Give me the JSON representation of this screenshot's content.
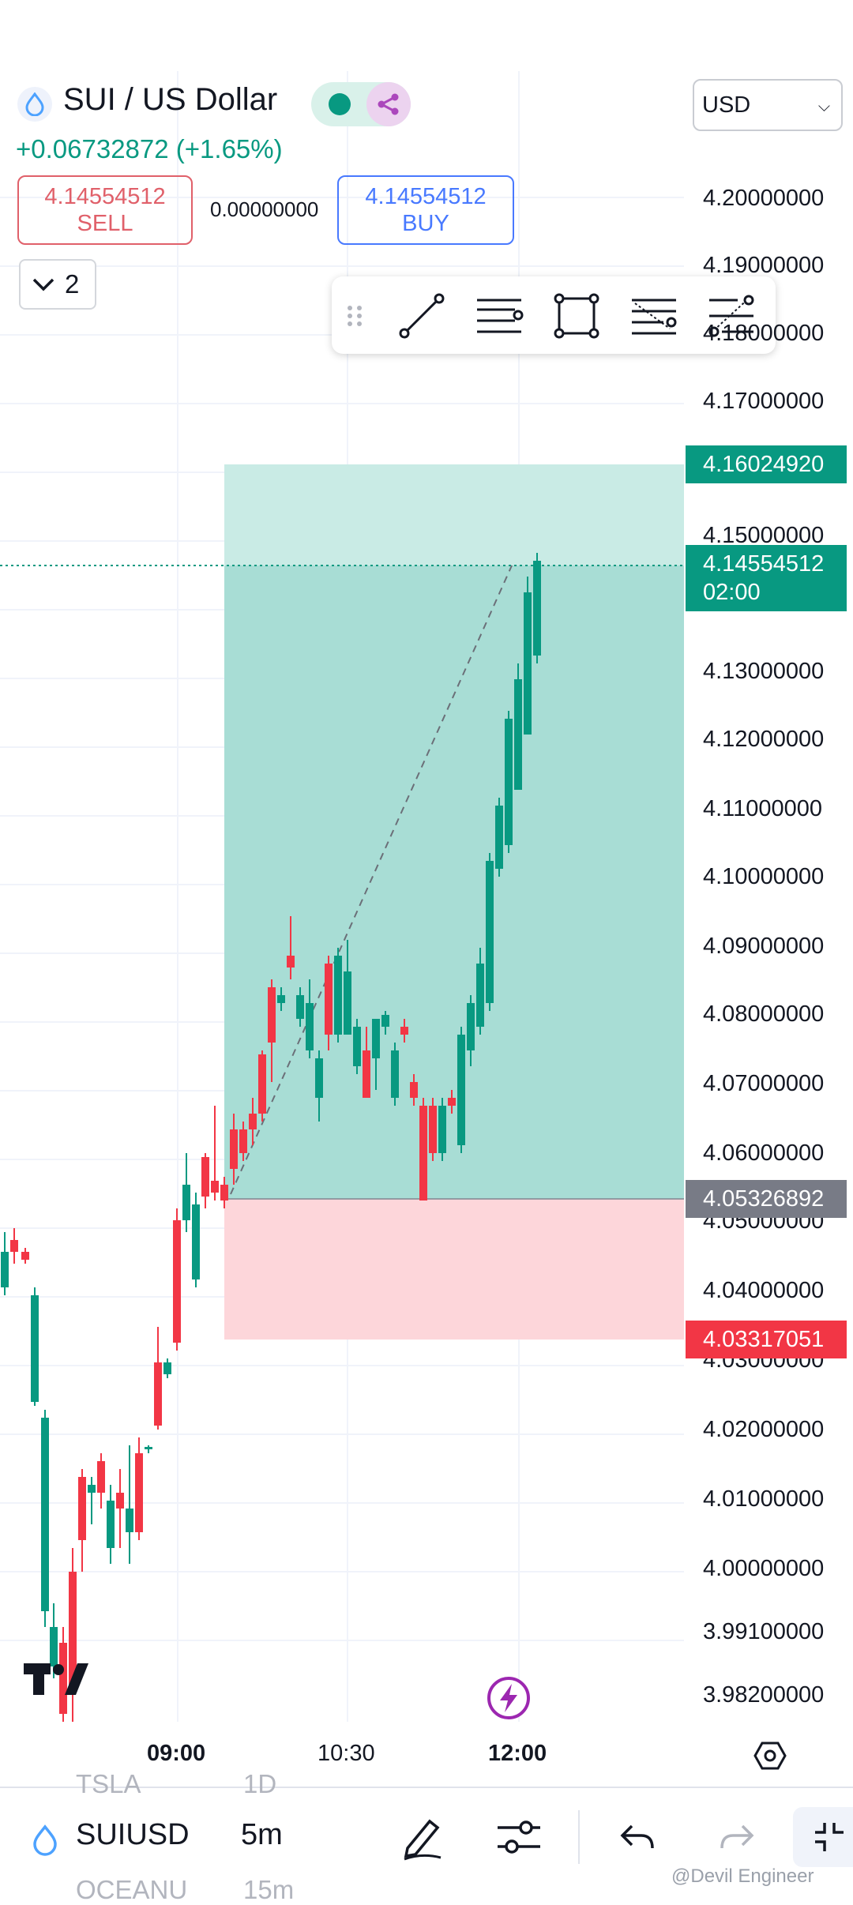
{
  "header": {
    "title": "SUI / US Dollar",
    "change": "+0.06732872 (+1.65%)",
    "currency": "USD"
  },
  "trade": {
    "sell_price": "4.14554512",
    "sell_label": "SELL",
    "spread": "0.00000000",
    "buy_price": "4.14554512",
    "buy_label": "BUY"
  },
  "layers_count": "2",
  "price_axis": [
    "4.20000000",
    "4.19000000",
    "4.18000000",
    "4.17000000",
    "4.15000000",
    "4.13000000",
    "4.12000000",
    "4.11000000",
    "4.10000000",
    "4.09000000",
    "4.08000000",
    "4.07000000",
    "4.06000000",
    "4.05000000",
    "4.04000000",
    "4.03000000",
    "4.02000000",
    "4.01000000",
    "4.00000000",
    "3.99100000",
    "3.98200000"
  ],
  "price_tags": {
    "target": "4.16024920",
    "current": "4.14554512",
    "countdown": "02:00",
    "entry": "4.05326892",
    "stop": "4.03317051"
  },
  "time_axis": [
    "09:00",
    "10:30",
    "12:00"
  ],
  "bottom_bar": {
    "symbol": "SUIUSD",
    "interval": "5m",
    "ghost_prev_symbol": "TSLA",
    "ghost_prev_interval": "1D",
    "ghost_next_symbol": "OCEANU",
    "ghost_next_interval": "15m"
  },
  "watermark": "@Devil Engineer",
  "colors": {
    "up": "#089981",
    "down": "#f23645",
    "target_zone": "#b2dfd8",
    "stop_zone": "#fcd4d8",
    "accent": "#2962ff"
  },
  "icons": [
    "sui-logo-icon",
    "share-icon",
    "chevron-down-icon",
    "drag-handle-icon",
    "trend-line-icon",
    "parallel-lines-icon",
    "rectangle-icon",
    "fib-retracement-icon",
    "fib-extension-icon",
    "tradingview-logo-icon",
    "lightning-icon",
    "settings-gear-icon",
    "pencil-icon",
    "sliders-icon",
    "undo-icon",
    "redo-icon",
    "fullscreen-icon"
  ]
}
